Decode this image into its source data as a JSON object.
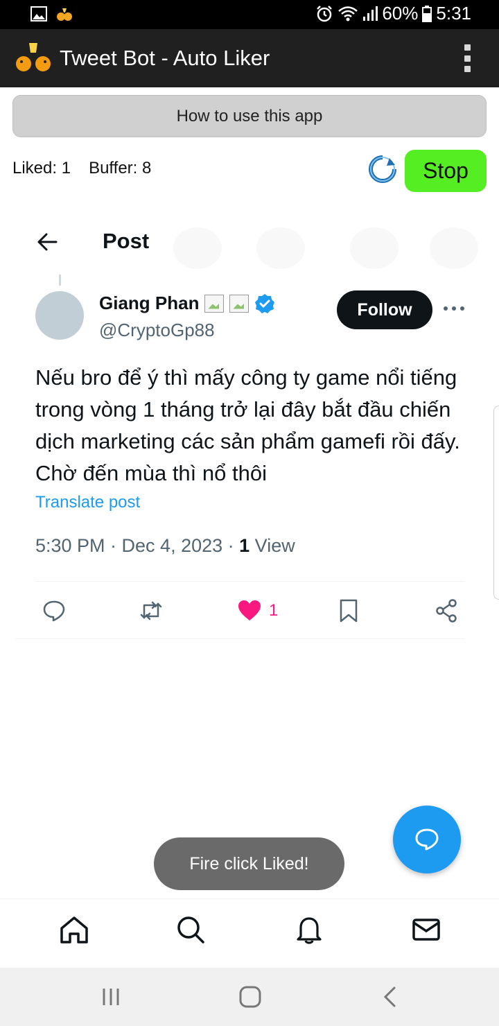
{
  "status_bar": {
    "battery": "60%",
    "time": "5:31",
    "icons": [
      "gallery-icon",
      "app-notification-icon",
      "alarm-icon",
      "wifi-icon",
      "signal-icon",
      "battery-icon"
    ]
  },
  "app_bar": {
    "title": "Tweet Bot - Auto Liker",
    "logo": "app-logo-icon",
    "menu_icon": "overflow-menu-icon"
  },
  "controls": {
    "how_to_label": "How to use this app",
    "liked_label": "Liked: 1",
    "buffer_label": "Buffer: 8",
    "stop_label": "Stop",
    "refresh_icon": "refresh-icon",
    "stop_color": "#55ee22"
  },
  "post_header": {
    "title": "Post",
    "back_icon": "back-arrow-icon"
  },
  "tweet": {
    "author_name": "Giang Phan",
    "author_handle": "@CryptoGp88",
    "follow_label": "Follow",
    "text": "Nếu bro để ý thì mấy công ty game nổi tiếng trong vòng 1 tháng trở lại đây bắt đầu chiến dịch marketing các sản phẩm gamefi rồi đấy. Chờ đến mùa thì nổ thôi",
    "translate_label": "Translate post",
    "meta_time": "5:30 PM · Dec 4, 2023 · ",
    "views_count": "1",
    "views_label": " View",
    "like_count": "1",
    "accent_color": "#1d9bf0",
    "like_color": "#f91880"
  },
  "toast": {
    "message": "Fire click Liked!"
  },
  "bottom_nav": {
    "items": [
      "home-icon",
      "search-icon",
      "notifications-icon",
      "messages-icon"
    ]
  },
  "system_nav": {
    "items": [
      "recent-apps-icon",
      "home-button-icon",
      "back-button-icon"
    ]
  }
}
